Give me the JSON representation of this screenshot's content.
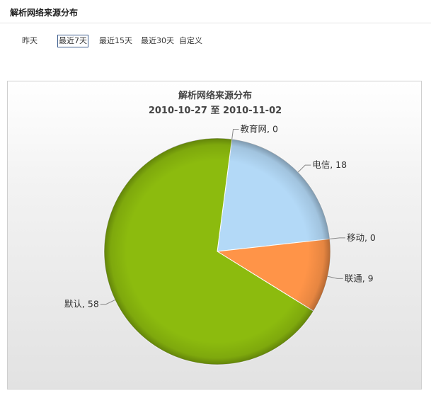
{
  "page": {
    "title": "解析网络来源分布"
  },
  "range_tabs": [
    {
      "label": "昨天",
      "active": false
    },
    {
      "label": "最近7天",
      "active": true
    },
    {
      "label": "最近15天",
      "active": false
    },
    {
      "label": "最近30天",
      "active": false
    },
    {
      "label": "自定义",
      "active": false
    }
  ],
  "chart_data": {
    "type": "pie",
    "title": "解析网络来源分布",
    "subtitle": "2010-10-27 至 2010-11-02",
    "slices": [
      {
        "label": "教育网",
        "value": 0,
        "color": "#8c8c8c"
      },
      {
        "label": "电信",
        "value": 18,
        "color": "#b3d9f7"
      },
      {
        "label": "移动",
        "value": 0,
        "color": "#c8a0a0"
      },
      {
        "label": "联通",
        "value": 9,
        "color": "#ff9448"
      },
      {
        "label": "默认",
        "value": 58,
        "color": "#8cbb0e"
      }
    ],
    "legend": false
  }
}
